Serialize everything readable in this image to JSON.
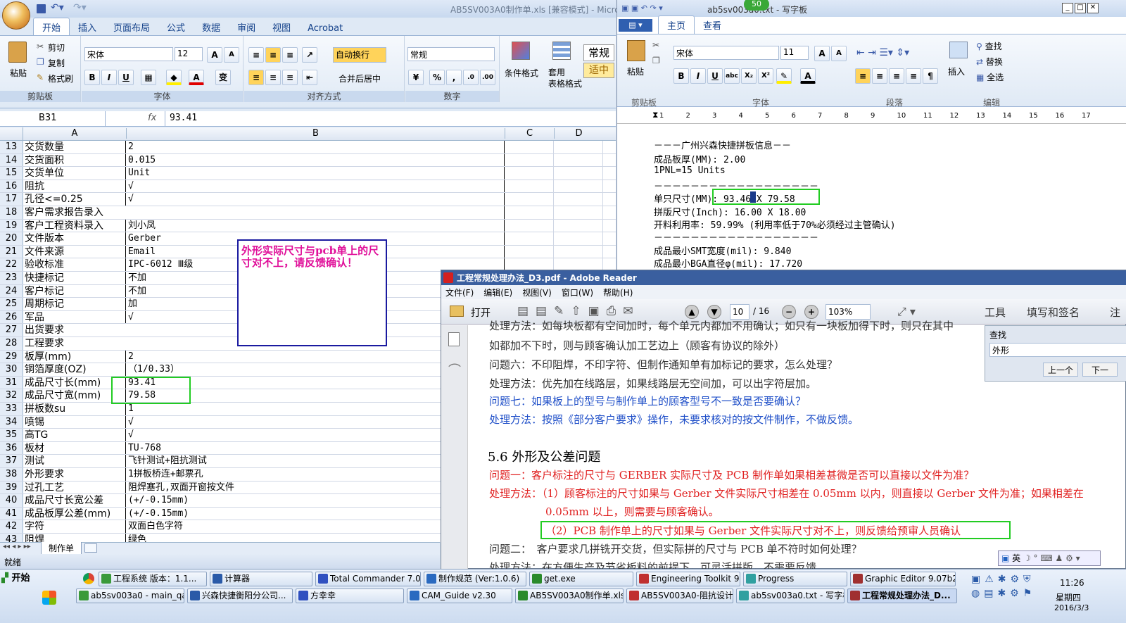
{
  "excel": {
    "title": "AB5SV003A0制作单.xls  [兼容模式] - Micro",
    "tabs": [
      "开始",
      "插入",
      "页面布局",
      "公式",
      "数据",
      "审阅",
      "视图",
      "Acrobat"
    ],
    "clipboard": {
      "paste": "粘贴",
      "cut": "剪切",
      "copy": "复制",
      "format_painter": "格式刷",
      "group": "剪贴板"
    },
    "font": {
      "name": "宋体",
      "size": "12",
      "group": "字体"
    },
    "align": {
      "wrap": "自动换行",
      "merge": "合并后居中",
      "group": "对齐方式"
    },
    "number": {
      "format": "常规",
      "group": "数字"
    },
    "styles": {
      "cond": "条件格式",
      "table": "套用\n表格格式",
      "normal": "常规",
      "medium": "适中"
    },
    "namebox": "B31",
    "fx": "fx",
    "formula": "93.41",
    "cols": [
      "A",
      "B",
      "C",
      "D"
    ],
    "rows": [
      [
        "13",
        "交货数量",
        "2"
      ],
      [
        "14",
        "交货面积",
        "0.015"
      ],
      [
        "15",
        "交货单位",
        "Unit"
      ],
      [
        "16",
        "阻抗",
        "√"
      ],
      [
        "17",
        "孔径<=0.25",
        "√"
      ],
      [
        "18",
        "客户需求报告录入",
        ""
      ],
      [
        "19",
        "客户工程资料录入",
        "刘小凤"
      ],
      [
        "20",
        "文件版本",
        "Gerber"
      ],
      [
        "21",
        "文件来源",
        "Email"
      ],
      [
        "22",
        "验收标准",
        "IPC-6012 Ⅲ级"
      ],
      [
        "23",
        "快捷标记",
        "不加"
      ],
      [
        "24",
        "客户标记",
        "不加"
      ],
      [
        "25",
        "周期标记",
        "加"
      ],
      [
        "26",
        "军品",
        "√"
      ],
      [
        "27",
        "出货要求",
        ""
      ],
      [
        "28",
        "工程要求",
        ""
      ],
      [
        "29",
        "板厚(mm)",
        "2"
      ],
      [
        "30",
        "铜箔厚度(OZ)",
        "（1/0.33）"
      ],
      [
        "31",
        "成品尺寸长(mm)",
        "93.41"
      ],
      [
        "32",
        "成品尺寸宽(mm)",
        "79.58"
      ],
      [
        "33",
        "拼板数su",
        "1"
      ],
      [
        "34",
        "喷锡",
        "√"
      ],
      [
        "35",
        "高TG",
        "√"
      ],
      [
        "36",
        "板材",
        "TU-768"
      ],
      [
        "37",
        "测试",
        "飞针测试+阻抗测试"
      ],
      [
        "38",
        "外形要求",
        "1拼板桥连+邮票孔"
      ],
      [
        "39",
        "过孔工艺",
        "阻焊塞孔,双面开窗按文件"
      ],
      [
        "40",
        "成品尺寸长宽公差",
        "(+/-0.15mm)"
      ],
      [
        "41",
        "成品板厚公差(mm)",
        "(+/-0.15mm)"
      ],
      [
        "42",
        "字符",
        "双面白色字符"
      ],
      [
        "43",
        "阻焊",
        "绿色"
      ]
    ],
    "annotation": "外形实际尺寸与pcb单上的尺寸对不上，请反馈确认！",
    "sheet_tab": "制作单",
    "status": "就绪"
  },
  "wordpad": {
    "title": "ab5sv003a0.txt - 写字板",
    "badge": "50",
    "tabs": [
      "主页",
      "查看"
    ],
    "paste": "粘贴",
    "font": "宋体",
    "size": "11",
    "insert": "插入",
    "find": "查找",
    "replace": "替换",
    "select_all": "全选",
    "groups": [
      "剪贴板",
      "字体",
      "段落",
      "编辑"
    ],
    "ruler": [
      "1",
      "2",
      "3",
      "4",
      "5",
      "6",
      "7",
      "8",
      "9",
      "10",
      "11",
      "12",
      "13",
      "14",
      "15",
      "16",
      "17"
    ],
    "lines": [
      "－－－广州兴森快捷拼板信息－－",
      "成品板厚(MM): 2.00",
      "1PNL=15 Units",
      "－－－－－－－－－－－－－－－－－－",
      "单只尺寸(MM): 93.46 X 79.58",
      "拼版尺寸(Inch): 16.00 X 18.00",
      "开料利用率: 59.99% (利用率低于70%必须经过主管确认)",
      "－－－－－－－－－－－－－－－－－－",
      "成品最小SMT宽度(mil): 9.840",
      "成品最小BGA直径φ(mil): 17.720"
    ]
  },
  "reader": {
    "title": "工程常规处理办法_D3.pdf - Adobe Reader",
    "menu": [
      "文件(F)",
      "编辑(E)",
      "视图(V)",
      "窗口(W)",
      "帮助(H)"
    ],
    "open": "打开",
    "page": "10",
    "pages": "/ 16",
    "zoom": "103%",
    "tools": "工具",
    "sign": "填写和签名",
    "comment": "注",
    "find_title": "查找",
    "find_value": "外形",
    "prev": "上一个",
    "next": "下一",
    "lines": [
      {
        "t": "处理方法：如每块板都有空间加时，每个单元内都加不用确认；如只有一块板加得下时，则只在其中",
        "c": "#333"
      },
      {
        "t": "如都加不下时，则与顾客确认加工艺边上（顾客有协议的除外）",
        "c": "#333"
      },
      {
        "t": "问题六：不印阻焊，不印字符、但制作通知单有加标记的要求，怎么处理？",
        "c": "#333"
      },
      {
        "t": "处理方法：优先加在线路层，如果线路层无空间加，可以出字符层加。",
        "c": "#333"
      },
      {
        "t": "问题七：如果板上的型号与制作单上的顾客型号不一致是否要确认？",
        "c": "#1f4fc8"
      },
      {
        "t": "处理方法：按照《部分客户要求》操作，未要求核对的按文件制作，不做反馈。",
        "c": "#1f4fc8"
      },
      {
        "t": "5.6 外形及公差问题",
        "c": "#000"
      },
      {
        "t": "问题一：客户标注的尺寸与 GERBER 实际尺寸及 PCB 制作单如果相差甚微是否可以直接以文件为准？",
        "c": "#e02020"
      },
      {
        "t": "处理方法：（1）顾客标注的尺寸如果与 Gerber 文件实际尺寸相差在 0.05mm 以内，则直接以 Gerber 文件为准；如果相差在",
        "c": "#e02020"
      },
      {
        "t": "0.05mm 以上，则需要与顾客确认。",
        "c": "#e02020"
      },
      {
        "t": "（2）PCB 制作单上的尺寸如果与 Gerber 文件实际尺寸对不上，则反馈给预审人员确认",
        "c": "#e02020"
      },
      {
        "t": "问题二：　客户要求几拼铣开交货，但实际拼的尺寸与 PCB 单不符时如何处理？",
        "c": "#333"
      },
      {
        "t": "处理方法：在方便生产及节省板料的前提下，可灵活拼版，不需要反馈",
        "c": "#333"
      }
    ]
  },
  "ime": "英",
  "taskbar": {
    "start": "开始",
    "row1": [
      "工程系统  版本：1.1...",
      "计算器",
      "Total Commander 7.0 p...",
      "制作规范 (Ver:1.0.6)",
      "get.exe",
      "Engineering Toolkit 9.0...",
      "Progress",
      "Graphic Editor 9.07b2 (..."
    ],
    "row2": [
      "ab5sv003a0 - main_qa",
      "兴森快捷衡阳分公司...",
      "方幸幸",
      "CAM_Guide v2.30",
      "AB5SV003A0制作单.xls ...",
      "AB5SV003A0-阻抗设计(...",
      "ab5sv003a0.txt - 写字板",
      "工程常规处理办法_D..."
    ],
    "time": "11:26",
    "day": "星期四",
    "date": "2016/3/3"
  },
  "colors": {
    "ribbon": "#dfe9f5",
    "highlight": "#22cc22",
    "annot_border": "#1a1aa0",
    "annot_text": "#e0109a",
    "pdf_red": "#e02020",
    "pdf_blue": "#1f4fc8"
  }
}
